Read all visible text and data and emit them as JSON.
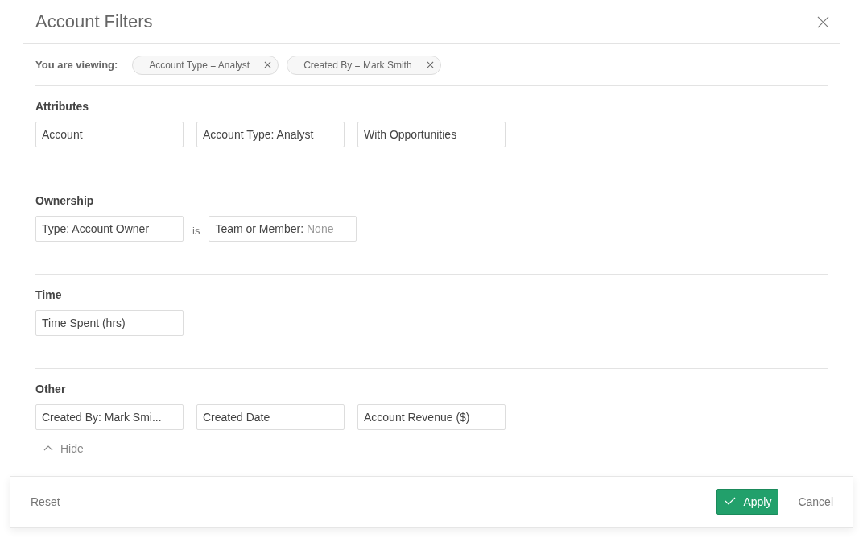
{
  "dialog": {
    "title": "Account Filters"
  },
  "viewing": {
    "label": "You are viewing:",
    "chips": [
      {
        "text": "Account Type = Analyst"
      },
      {
        "text": "Created By = Mark Smith"
      }
    ]
  },
  "sections": [
    {
      "title": "Attributes",
      "items": [
        {
          "kind": "field",
          "label": "Account"
        },
        {
          "kind": "field",
          "label": "Account Type: Analyst"
        },
        {
          "kind": "field",
          "label": "With Opportunities"
        }
      ]
    },
    {
      "title": "Ownership",
      "items": [
        {
          "kind": "field",
          "label": "Type: Account Owner"
        },
        {
          "kind": "word",
          "label": "is"
        },
        {
          "kind": "field",
          "label": "Team or Member:",
          "value": "None"
        }
      ]
    },
    {
      "title": "Time",
      "items": [
        {
          "kind": "field",
          "label": "Time Spent (hrs)"
        }
      ]
    },
    {
      "title": "Other",
      "items": [
        {
          "kind": "field",
          "label": "Created By: Mark Smi..."
        },
        {
          "kind": "field",
          "label": "Created Date"
        },
        {
          "kind": "field",
          "label": "Account Revenue ($)"
        }
      ]
    }
  ],
  "toggle": {
    "label": "Hide",
    "expanded": true
  },
  "footer": {
    "reset": "Reset",
    "apply": "Apply",
    "cancel": "Cancel"
  }
}
